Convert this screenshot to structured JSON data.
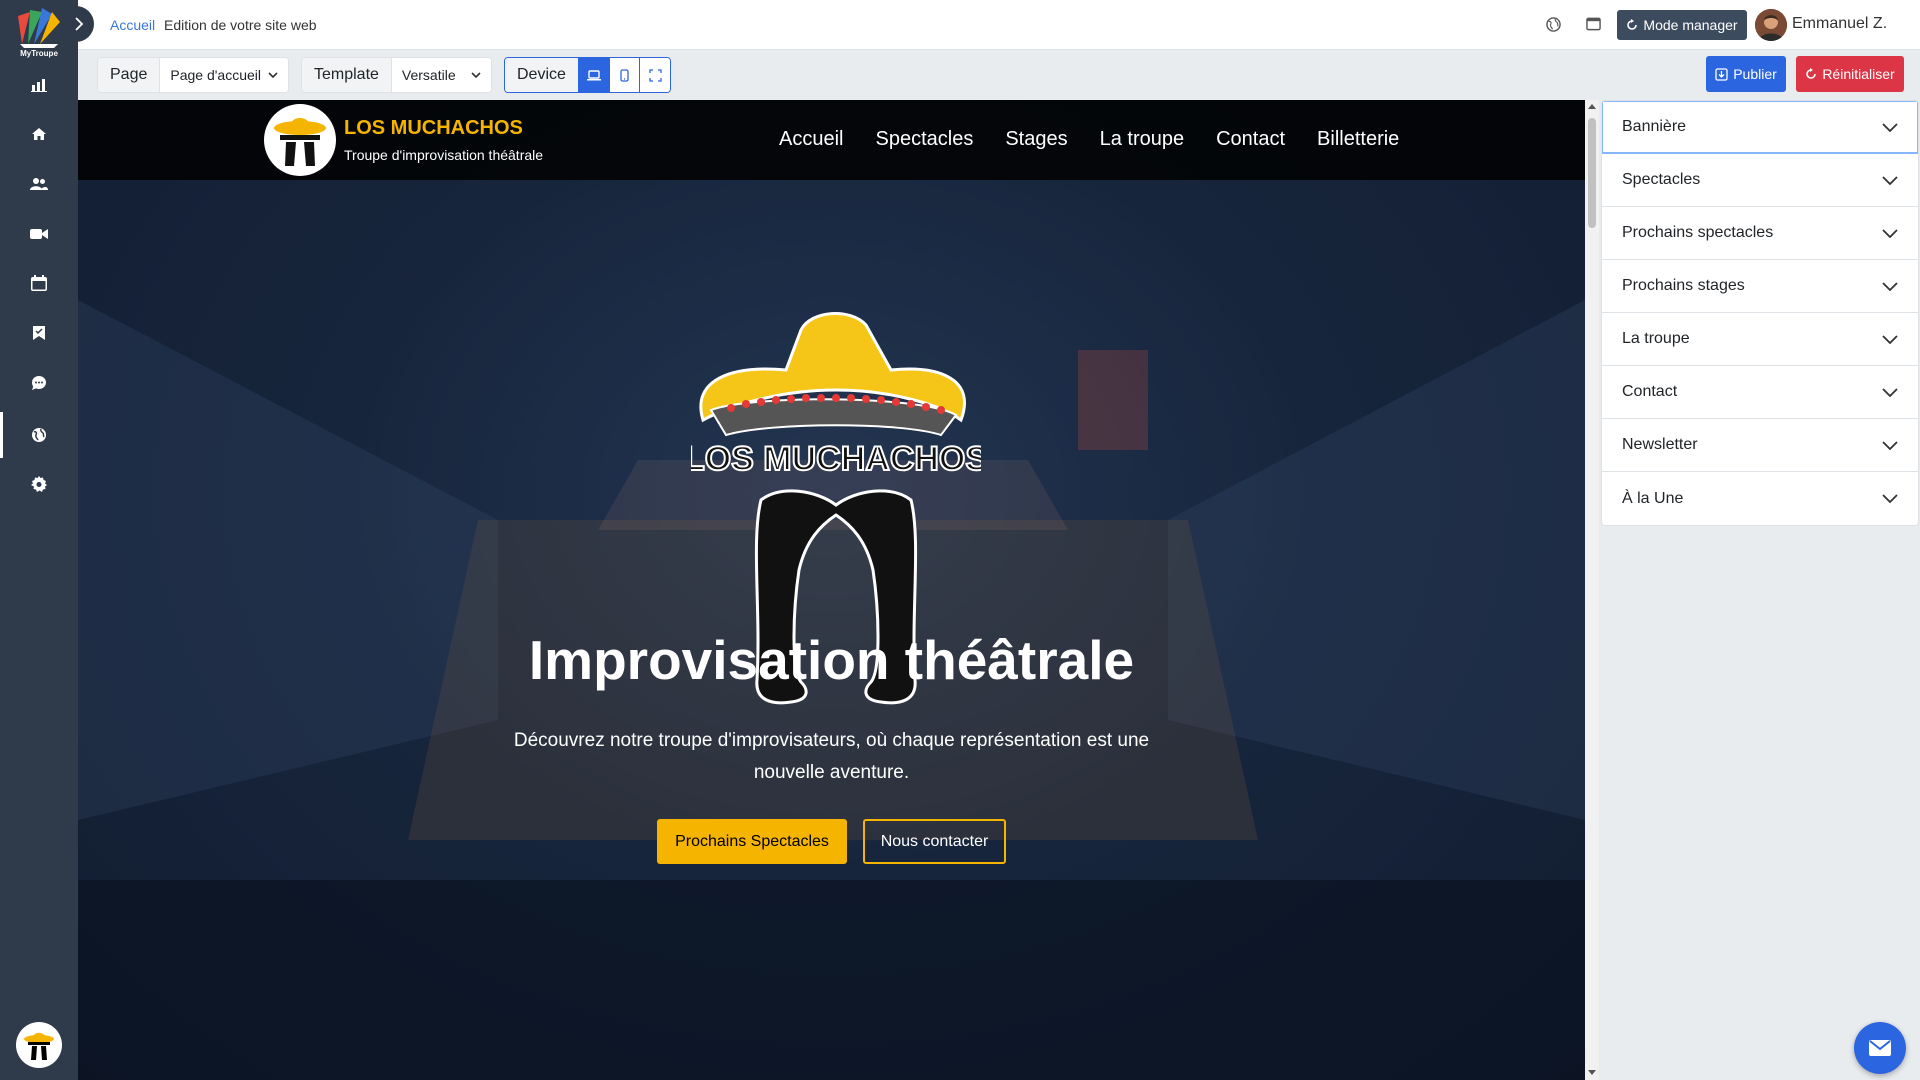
{
  "sidebar": {
    "logo_text": "MyTroupe",
    "nav": [
      {
        "icon": "chart-icon"
      },
      {
        "icon": "home-icon"
      },
      {
        "icon": "users-icon"
      },
      {
        "icon": "video-icon"
      },
      {
        "icon": "calendar-icon"
      },
      {
        "icon": "bookmark-icon"
      },
      {
        "icon": "chat-icon"
      },
      {
        "icon": "globe-icon"
      },
      {
        "icon": "gear-icon"
      }
    ],
    "active_item": "globe-icon"
  },
  "topbar": {
    "breadcrumb_link": "Accueil",
    "breadcrumb_text": "Edition de votre site web",
    "manager_label": "Mode manager",
    "user_name": "Emmanuel Z."
  },
  "toolbar": {
    "page_label": "Page",
    "page_value": "Page d'accueil",
    "template_label": "Template",
    "template_value": "Versatile",
    "device_label": "Device",
    "devices": [
      "desktop-icon",
      "mobile-icon",
      "fullscreen-icon"
    ],
    "active_device": "desktop-icon",
    "publish_label": "Publier",
    "reset_label": "Réinitialiser"
  },
  "site": {
    "name": "LOS MUCHACHOS",
    "tagline": "Troupe d'improvisation théâtrale",
    "menu": [
      "Accueil",
      "Spectacles",
      "Stages",
      "La troupe",
      "Contact",
      "Billetterie"
    ],
    "logo_text": "LOS MUCHACHOS",
    "hero_title": "Improvisation théâtrale",
    "hero_subtitle": "Découvrez notre troupe d'improvisateurs, où chaque représentation est une nouvelle aventure.",
    "cta_primary": "Prochains Spectacles",
    "cta_secondary": "Nous contacter"
  },
  "panel": {
    "sections": [
      "Bannière",
      "Spectacles",
      "Prochains spectacles",
      "Prochains stages",
      "La troupe",
      "Contact",
      "Newsletter",
      "À la Une"
    ],
    "active_section": "Bannière"
  },
  "colors": {
    "sidebar": "#2f3a4a",
    "accent": "#f5b400",
    "primary": "#2b66e0",
    "danger": "#dc3545"
  }
}
